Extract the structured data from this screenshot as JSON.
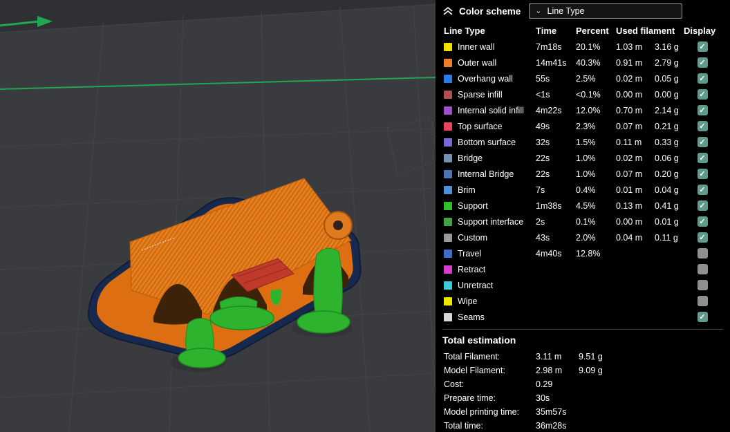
{
  "panel": {
    "header": {
      "collapse_icon": "chevron-double-up-icon",
      "title": "Color scheme",
      "dropdown": {
        "caret_icon": "chevron-down-icon",
        "value": "Line Type"
      }
    },
    "table": {
      "columns": [
        "Line Type",
        "Time",
        "Percent",
        "Used filament",
        "Display"
      ],
      "rows": [
        {
          "label": "Inner wall",
          "color": "#F5E100",
          "time": "7m18s",
          "percent": "20.1%",
          "used_m": "1.03 m",
          "used_g": "3.16 g",
          "display": true
        },
        {
          "label": "Outer wall",
          "color": "#EF7E2E",
          "time": "14m41s",
          "percent": "40.3%",
          "used_m": "0.91 m",
          "used_g": "2.79 g",
          "display": true
        },
        {
          "label": "Overhang wall",
          "color": "#2A7CE8",
          "time": "55s",
          "percent": "2.5%",
          "used_m": "0.02 m",
          "used_g": "0.05 g",
          "display": true
        },
        {
          "label": "Sparse infill",
          "color": "#B05050",
          "time": "<1s",
          "percent": "<0.1%",
          "used_m": "0.00 m",
          "used_g": "0.00 g",
          "display": true
        },
        {
          "label": "Internal solid infill",
          "color": "#A04DC8",
          "time": "4m22s",
          "percent": "12.0%",
          "used_m": "0.70 m",
          "used_g": "2.14 g",
          "display": true
        },
        {
          "label": "Top surface",
          "color": "#E8455B",
          "time": "49s",
          "percent": "2.3%",
          "used_m": "0.07 m",
          "used_g": "0.21 g",
          "display": true
        },
        {
          "label": "Bottom surface",
          "color": "#7B68D8",
          "time": "32s",
          "percent": "1.5%",
          "used_m": "0.11 m",
          "used_g": "0.33 g",
          "display": true
        },
        {
          "label": "Bridge",
          "color": "#7690B0",
          "time": "22s",
          "percent": "1.0%",
          "used_m": "0.02 m",
          "used_g": "0.06 g",
          "display": true
        },
        {
          "label": "Internal Bridge",
          "color": "#4E74B5",
          "time": "22s",
          "percent": "1.0%",
          "used_m": "0.07 m",
          "used_g": "0.20 g",
          "display": true
        },
        {
          "label": "Brim",
          "color": "#4F8FD6",
          "time": "7s",
          "percent": "0.4%",
          "used_m": "0.01 m",
          "used_g": "0.04 g",
          "display": true
        },
        {
          "label": "Support",
          "color": "#2FBE2F",
          "time": "1m38s",
          "percent": "4.5%",
          "used_m": "0.13 m",
          "used_g": "0.41 g",
          "display": true
        },
        {
          "label": "Support interface",
          "color": "#44A244",
          "time": "2s",
          "percent": "0.1%",
          "used_m": "0.00 m",
          "used_g": "0.01 g",
          "display": true
        },
        {
          "label": "Custom",
          "color": "#999999",
          "time": "43s",
          "percent": "2.0%",
          "used_m": "0.04 m",
          "used_g": "0.11 g",
          "display": true
        },
        {
          "label": "Travel",
          "color": "#3F6EC8",
          "time": "4m40s",
          "percent": "12.8%",
          "used_m": "",
          "used_g": "",
          "display": false
        },
        {
          "label": "Retract",
          "color": "#D93BCB",
          "time": "",
          "percent": "",
          "used_m": "",
          "used_g": "",
          "display": false
        },
        {
          "label": "Unretract",
          "color": "#3FCBD9",
          "time": "",
          "percent": "",
          "used_m": "",
          "used_g": "",
          "display": false
        },
        {
          "label": "Wipe",
          "color": "#EFE600",
          "time": "",
          "percent": "",
          "used_m": "",
          "used_g": "",
          "display": false
        },
        {
          "label": "Seams",
          "color": "#D8D8D8",
          "time": "",
          "percent": "",
          "used_m": "",
          "used_g": "",
          "display": true
        }
      ]
    },
    "totals": {
      "title": "Total estimation",
      "rows": [
        {
          "label": "Total Filament:",
          "value1": "3.11 m",
          "value2": "9.51 g"
        },
        {
          "label": "Model Filament:",
          "value1": "2.98 m",
          "value2": "9.09 g"
        },
        {
          "label": "Cost:",
          "value1": "0.29",
          "value2": ""
        },
        {
          "label": "Prepare time:",
          "value1": "30s",
          "value2": ""
        },
        {
          "label": "Model printing time:",
          "value1": "35m57s",
          "value2": ""
        },
        {
          "label": "Total time:",
          "value1": "36m28s",
          "value2": ""
        }
      ]
    },
    "colors": {
      "checkbox_checked": "#5E9B8A",
      "checkbox_unchecked": "#8F8F8F",
      "panel_bg": "#000000",
      "accent_green": "#21A653"
    }
  }
}
